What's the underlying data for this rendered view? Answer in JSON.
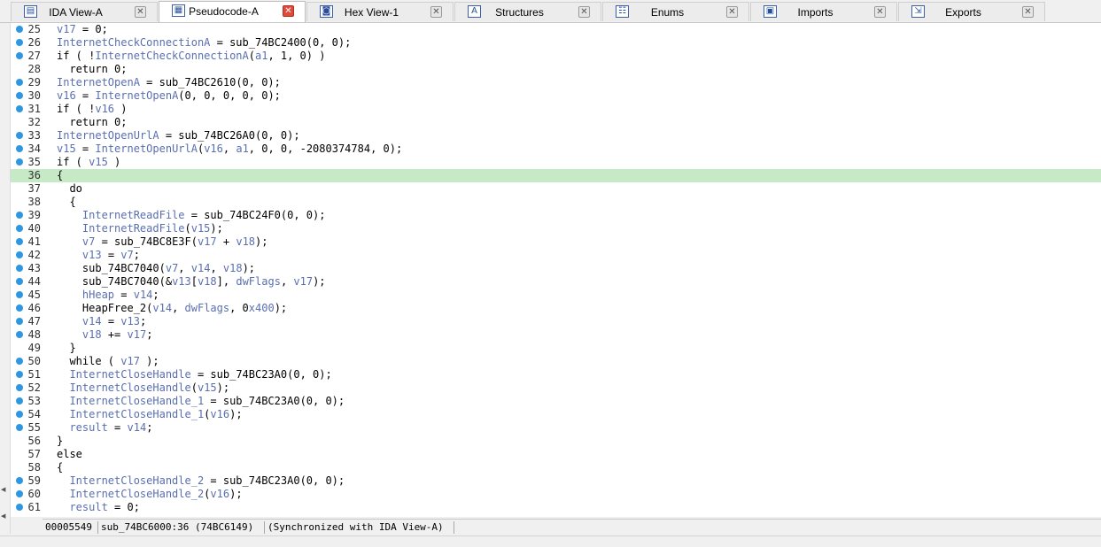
{
  "tabs": [
    {
      "label": "IDA View-A",
      "icon": "ida-view-icon",
      "glyph": "▤",
      "active": false
    },
    {
      "label": "Pseudocode-A",
      "icon": "pseudocode-icon",
      "glyph": "▦",
      "active": true
    },
    {
      "label": "Hex View-1",
      "icon": "hex-view-icon",
      "glyph": "◙",
      "active": false
    },
    {
      "label": "Structures",
      "icon": "structures-icon",
      "glyph": "A",
      "active": false
    },
    {
      "label": "Enums",
      "icon": "enums-icon",
      "glyph": "☷",
      "active": false
    },
    {
      "label": "Imports",
      "icon": "imports-icon",
      "glyph": "▣",
      "active": false
    },
    {
      "label": "Exports",
      "icon": "exports-icon",
      "glyph": "⇲",
      "active": false
    }
  ],
  "close_glyph": "✕",
  "code_lines": [
    {
      "n": "25",
      "bp": true,
      "code": "v17 = 0;"
    },
    {
      "n": "26",
      "bp": true,
      "code": "InternetCheckConnectionA = sub_74BC2400(0, 0);"
    },
    {
      "n": "27",
      "bp": true,
      "code": "if ( !InternetCheckConnectionA(a1, 1, 0) )"
    },
    {
      "n": "28",
      "bp": false,
      "code": "  return 0;"
    },
    {
      "n": "29",
      "bp": true,
      "code": "InternetOpenA = sub_74BC2610(0, 0);"
    },
    {
      "n": "30",
      "bp": true,
      "code": "v16 = InternetOpenA(0, 0, 0, 0, 0);"
    },
    {
      "n": "31",
      "bp": true,
      "code": "if ( !v16 )"
    },
    {
      "n": "32",
      "bp": false,
      "code": "  return 0;"
    },
    {
      "n": "33",
      "bp": true,
      "code": "InternetOpenUrlA = sub_74BC26A0(0, 0);"
    },
    {
      "n": "34",
      "bp": true,
      "code": "v15 = InternetOpenUrlA(v16, a1, 0, 0, -2080374784, 0);"
    },
    {
      "n": "35",
      "bp": true,
      "code": "if ( v15 )"
    },
    {
      "n": "36",
      "bp": false,
      "code": "{",
      "current": true
    },
    {
      "n": "37",
      "bp": false,
      "code": "  do"
    },
    {
      "n": "38",
      "bp": false,
      "code": "  {"
    },
    {
      "n": "39",
      "bp": true,
      "code": "    InternetReadFile = sub_74BC24F0(0, 0);"
    },
    {
      "n": "40",
      "bp": true,
      "code": "    InternetReadFile(v15);"
    },
    {
      "n": "41",
      "bp": true,
      "code": "    v7 = sub_74BC8E3F(v17 + v18);"
    },
    {
      "n": "42",
      "bp": true,
      "code": "    v13 = v7;"
    },
    {
      "n": "43",
      "bp": true,
      "code": "    sub_74BC7040(v7, v14, v18);"
    },
    {
      "n": "44",
      "bp": true,
      "code": "    sub_74BC7040(&v13[v18], dwFlags, v17);"
    },
    {
      "n": "45",
      "bp": true,
      "code": "    hHeap = v14;"
    },
    {
      "n": "46",
      "bp": true,
      "code": "    HeapFree_2(v14, dwFlags, 0x400);"
    },
    {
      "n": "47",
      "bp": true,
      "code": "    v14 = v13;"
    },
    {
      "n": "48",
      "bp": true,
      "code": "    v18 += v17;"
    },
    {
      "n": "49",
      "bp": false,
      "code": "  }"
    },
    {
      "n": "50",
      "bp": true,
      "code": "  while ( v17 );"
    },
    {
      "n": "51",
      "bp": true,
      "code": "  InternetCloseHandle = sub_74BC23A0(0, 0);"
    },
    {
      "n": "52",
      "bp": true,
      "code": "  InternetCloseHandle(v15);"
    },
    {
      "n": "53",
      "bp": true,
      "code": "  InternetCloseHandle_1 = sub_74BC23A0(0, 0);"
    },
    {
      "n": "54",
      "bp": true,
      "code": "  InternetCloseHandle_1(v16);"
    },
    {
      "n": "55",
      "bp": true,
      "code": "  result = v14;"
    },
    {
      "n": "56",
      "bp": false,
      "code": "}"
    },
    {
      "n": "57",
      "bp": false,
      "code": "else"
    },
    {
      "n": "58",
      "bp": false,
      "code": "{"
    },
    {
      "n": "59",
      "bp": true,
      "code": "  InternetCloseHandle_2 = sub_74BC23A0(0, 0);"
    },
    {
      "n": "60",
      "bp": true,
      "code": "  InternetCloseHandle_2(v16);"
    },
    {
      "n": "61",
      "bp": true,
      "code": "  result = 0;"
    }
  ],
  "status": {
    "offset": "00005549",
    "location": "sub_74BC6000:36 (74BC6149)",
    "sync": "(Synchronized with IDA View-A)"
  },
  "colors": {
    "breakpoint": "#2f97e0",
    "current_line": "#c6e9c6",
    "variable": "#5a6fb0",
    "keyword": "#000000",
    "active_close": "#e04a3a"
  }
}
